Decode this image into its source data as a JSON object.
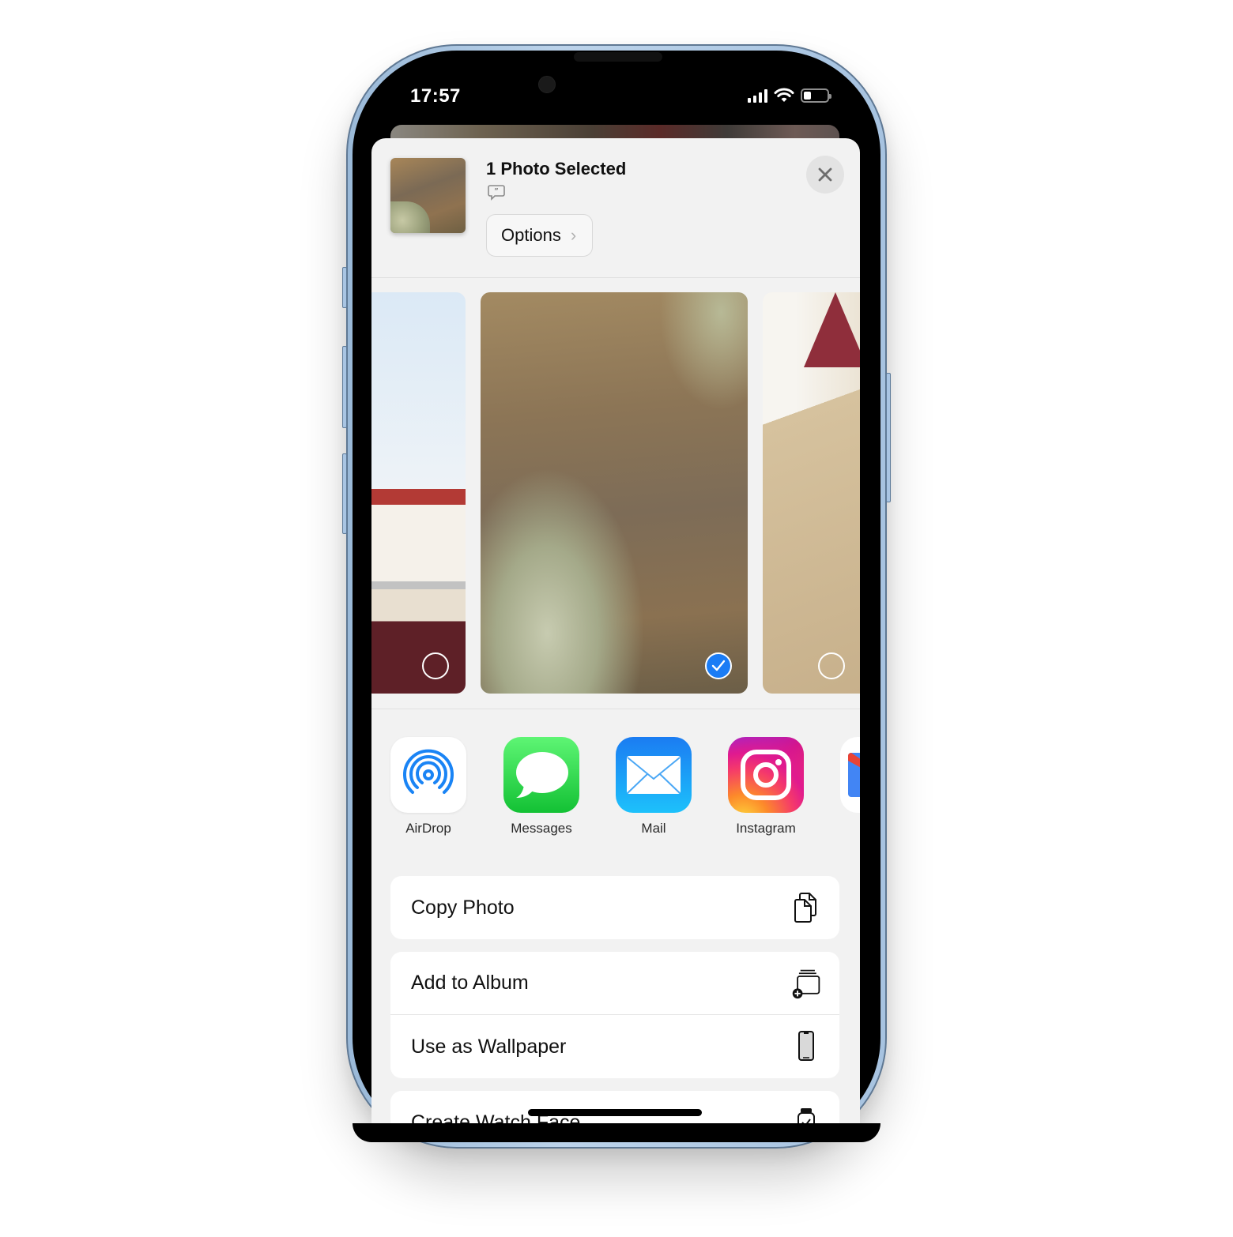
{
  "status_bar": {
    "time": "17:57",
    "signal_bars": 4,
    "battery_level_percent": 25
  },
  "share_sheet": {
    "title": "1 Photo Selected",
    "caption_icon": "quote-bubble-icon",
    "options_label": "Options",
    "close_icon": "close-icon"
  },
  "photos": [
    {
      "name": "street-building-photo",
      "selected": false
    },
    {
      "name": "cliff-rock-photo",
      "selected": true
    },
    {
      "name": "church-tower-photo",
      "selected": false
    }
  ],
  "apps": [
    {
      "label": "AirDrop",
      "icon": "airdrop-icon"
    },
    {
      "label": "Messages",
      "icon": "messages-icon"
    },
    {
      "label": "Mail",
      "icon": "mail-icon"
    },
    {
      "label": "Instagram",
      "icon": "instagram-icon"
    },
    {
      "label": "",
      "icon": "gmail-icon"
    }
  ],
  "actions": {
    "group1": [
      {
        "label": "Copy Photo",
        "icon": "copy-icon"
      }
    ],
    "group2": [
      {
        "label": "Add to Album",
        "icon": "add-to-album-icon"
      },
      {
        "label": "Use as Wallpaper",
        "icon": "iphone-icon"
      }
    ],
    "group3": [
      {
        "label": "Create Watch Face",
        "icon": "watch-icon"
      }
    ]
  },
  "colors": {
    "accent_blue": "#1a7cf5",
    "frame_blue": "#a7c3e0",
    "sheet_bg": "#f2f2f2"
  }
}
